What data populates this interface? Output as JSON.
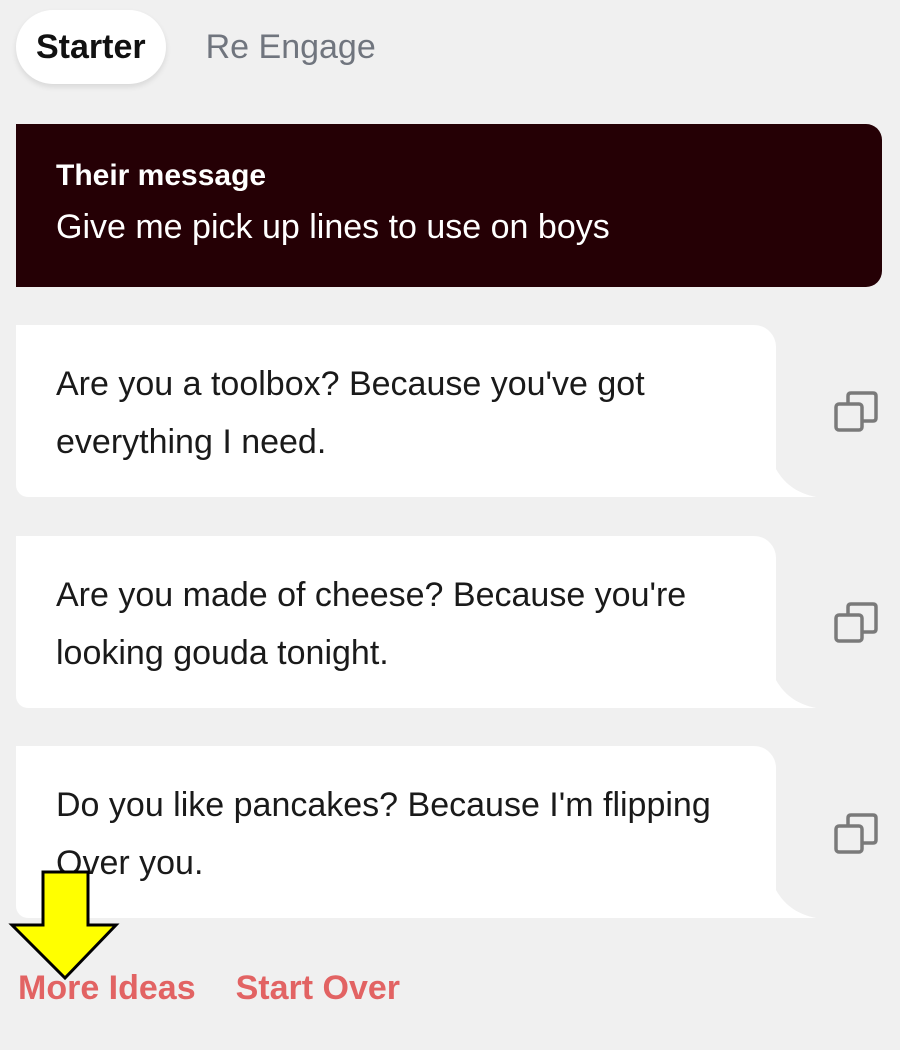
{
  "tabs": [
    {
      "label": "Starter",
      "active": true
    },
    {
      "label": "Re Engage",
      "active": false
    }
  ],
  "their_message": {
    "title": "Their message",
    "text": "Give me pick up lines to use on boys"
  },
  "suggestions": [
    {
      "text": "Are you a toolbox? Because you've got everything I need.",
      "copy_icon": "copy-icon"
    },
    {
      "text": "Are you made of cheese? Because you're looking gouda tonight.",
      "copy_icon": "copy-icon"
    },
    {
      "text": "Do you like pancakes? Because I'm flipping Over you.",
      "copy_icon": "copy-icon"
    }
  ],
  "footer": {
    "more_ideas_label": "More Ideas",
    "start_over_label": "Start Over"
  },
  "colors": {
    "background": "#f0f0f0",
    "their_message_bg": "#250005",
    "accent_link": "#e26363",
    "annotation_arrow": "#ffff00"
  }
}
